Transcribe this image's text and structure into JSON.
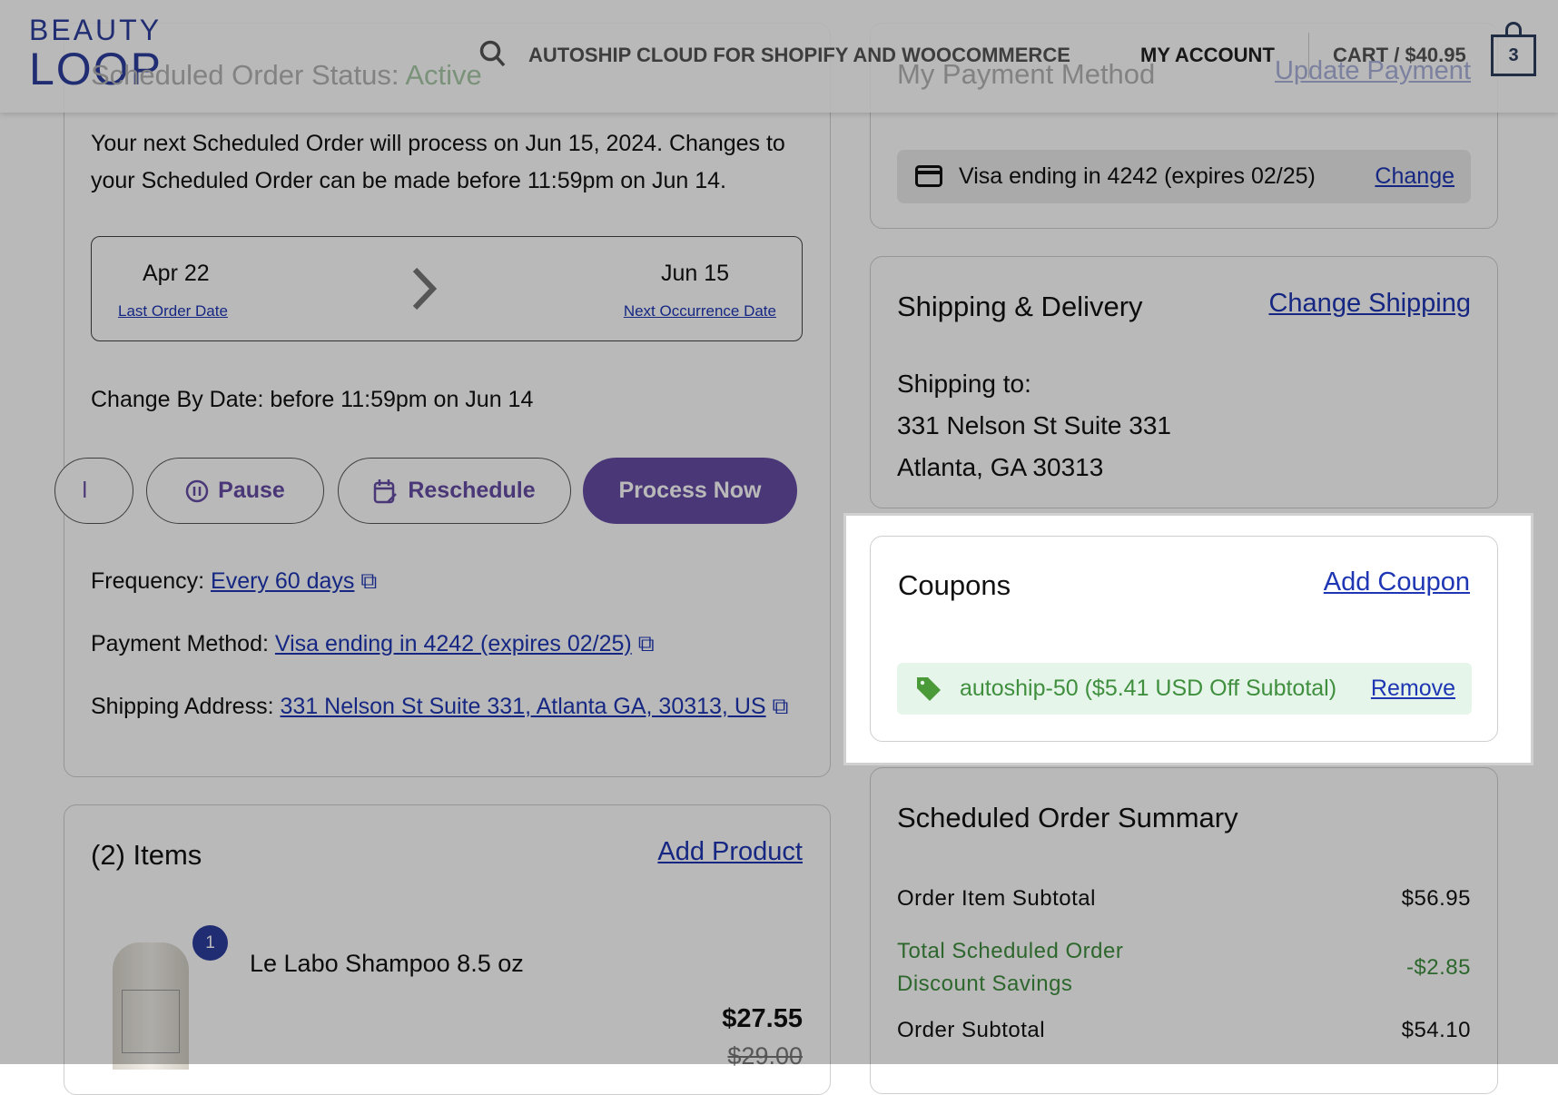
{
  "header": {
    "logo_top": "BEAUTY",
    "logo_bottom": "LOOP",
    "nav": [
      "AUTOSHIP CLOUD FOR SHOPIFY AND WOOCOMMERCE",
      "MY ACCOUNT"
    ],
    "cart_label": "CART / $40.95",
    "cart_count": "3",
    "search_icon": "search-icon"
  },
  "status": {
    "label": "Scheduled Order Status: ",
    "value": "Active",
    "notice": "Your next Scheduled Order will process on Jun 15, 2024. Changes to your Scheduled Order can be made before 11:59pm on Jun 14.",
    "last_date": "Apr 22",
    "last_label": "Last Order Date",
    "next_date": "Jun 15",
    "next_label": "Next Occurrence Date",
    "change_by": "Change By Date: before 11:59pm on Jun 14",
    "buttons": {
      "partial": "l",
      "pause": "Pause",
      "reschedule": "Reschedule",
      "process": "Process Now"
    },
    "frequency_label": "Frequency:",
    "frequency_value": "Every 60 days",
    "payment_label": "Payment Method:",
    "payment_value": "Visa ending in 4242 (expires 02/25)",
    "shipping_label": "Shipping Address:",
    "shipping_value": "331 Nelson St Suite 331, Atlanta GA, 30313, US"
  },
  "items": {
    "title": "(2) Items",
    "add": "Add Product",
    "list": [
      {
        "qty": "1",
        "name": "Le Labo Shampoo 8.5 oz",
        "price": "$27.55",
        "original_price": "$29.00"
      }
    ]
  },
  "payment": {
    "title": "My Payment Method",
    "update": "Update Payment",
    "card": "Visa ending in 4242 (expires 02/25)",
    "change": "Change"
  },
  "shipping": {
    "title": "Shipping & Delivery",
    "change": "Change Shipping",
    "to": "Shipping to:",
    "line1": "331 Nelson St Suite 331",
    "line2": "Atlanta, GA 30313"
  },
  "coupons": {
    "title": "Coupons",
    "add": "Add Coupon",
    "code": "autoship-50 ($5.41 USD Off Subtotal)",
    "remove": "Remove"
  },
  "summary": {
    "title": "Scheduled Order Summary",
    "rows": [
      {
        "label": "Order Item Subtotal",
        "value": "$56.95"
      },
      {
        "label1": "Total Scheduled Order",
        "label2": "Discount Savings",
        "value": "-$2.85"
      },
      {
        "label": "Order Subtotal",
        "value": "$54.10"
      }
    ]
  },
  "colors": {
    "accent": "#664da5",
    "link": "#1e36b4",
    "green": "#3f8f3f",
    "overlay_bg": "#b9b9b9"
  }
}
